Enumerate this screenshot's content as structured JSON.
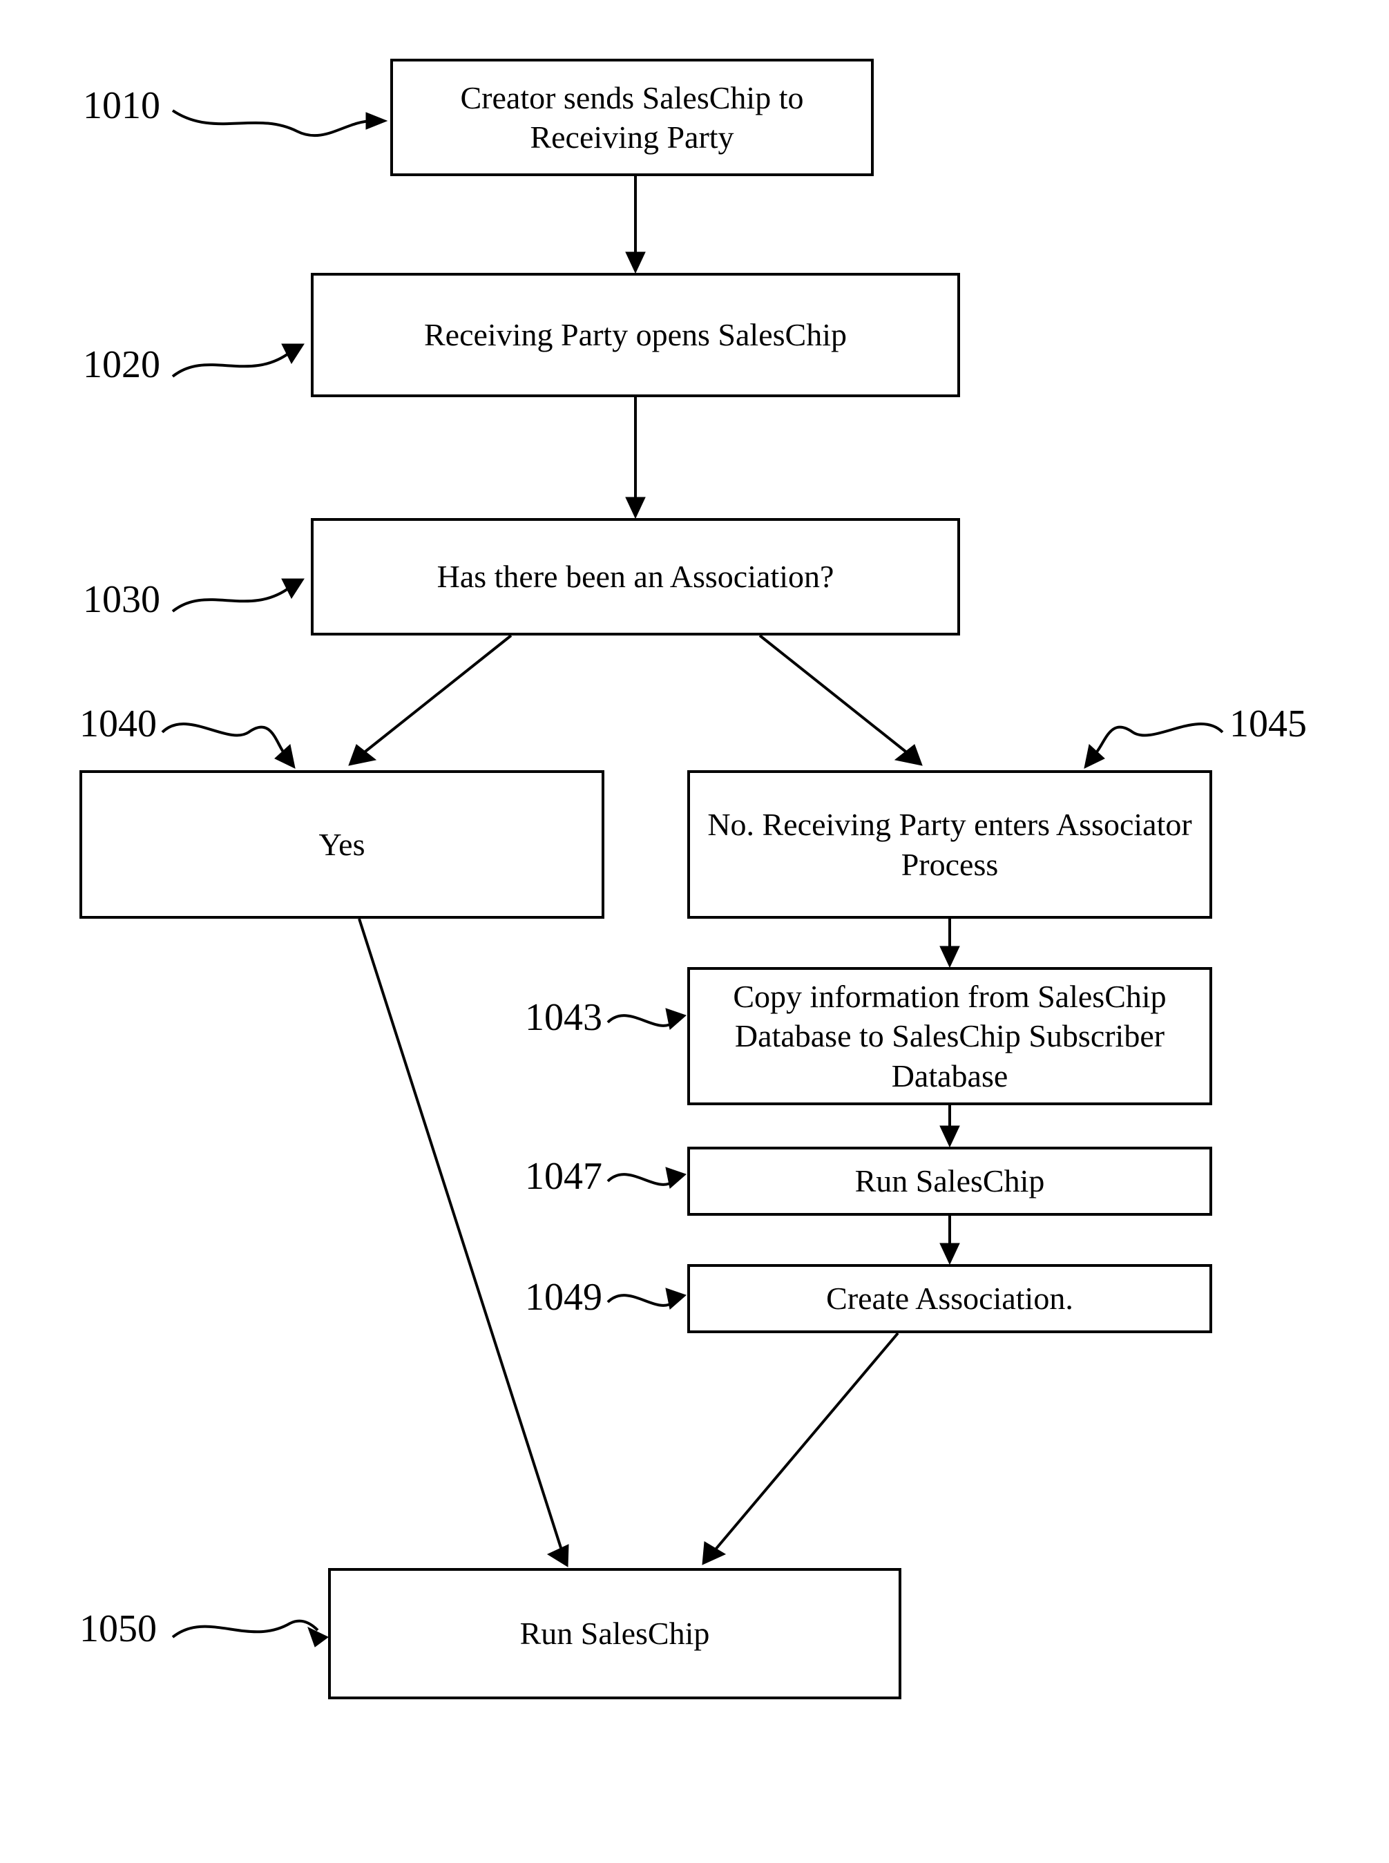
{
  "labels": {
    "l1010": "1010",
    "l1020": "1020",
    "l1030": "1030",
    "l1040": "1040",
    "l1045": "1045",
    "l1043": "1043",
    "l1047": "1047",
    "l1049": "1049",
    "l1050": "1050"
  },
  "boxes": {
    "b1010": "Creator sends SalesChip to Receiving Party",
    "b1020": "Receiving Party opens SalesChip",
    "b1030": "Has there been an Association?",
    "b1040": "Yes",
    "b1045": "No. Receiving Party enters Associator Process",
    "b1043": "Copy information from SalesChip Database to SalesChip Subscriber Database",
    "b1047": "Run SalesChip",
    "b1049": "Create Association.",
    "b1050": "Run SalesChip"
  },
  "chart_data": {
    "type": "flowchart",
    "nodes": [
      {
        "id": "1010",
        "label": "Creator sends SalesChip to Receiving Party"
      },
      {
        "id": "1020",
        "label": "Receiving Party opens SalesChip"
      },
      {
        "id": "1030",
        "label": "Has there been an Association?"
      },
      {
        "id": "1040",
        "label": "Yes"
      },
      {
        "id": "1045",
        "label": "No. Receiving Party enters Associator Process"
      },
      {
        "id": "1043",
        "label": "Copy information from SalesChip Database to SalesChip Subscriber Database"
      },
      {
        "id": "1047",
        "label": "Run SalesChip"
      },
      {
        "id": "1049",
        "label": "Create Association."
      },
      {
        "id": "1050",
        "label": "Run SalesChip"
      }
    ],
    "edges": [
      {
        "from": "1010",
        "to": "1020"
      },
      {
        "from": "1020",
        "to": "1030"
      },
      {
        "from": "1030",
        "to": "1040",
        "branch": "Yes"
      },
      {
        "from": "1030",
        "to": "1045",
        "branch": "No"
      },
      {
        "from": "1045",
        "to": "1043"
      },
      {
        "from": "1043",
        "to": "1047"
      },
      {
        "from": "1047",
        "to": "1049"
      },
      {
        "from": "1049",
        "to": "1050"
      },
      {
        "from": "1040",
        "to": "1050"
      }
    ]
  }
}
